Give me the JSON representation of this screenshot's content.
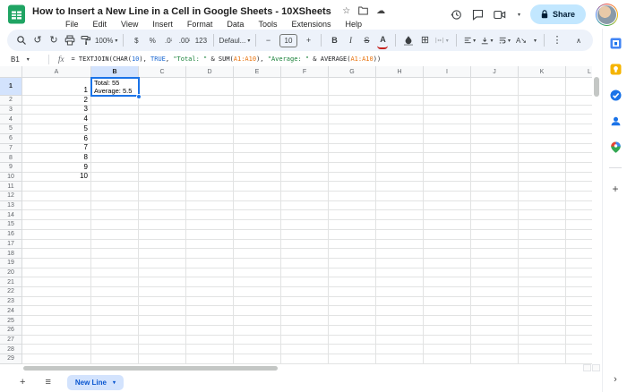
{
  "titlebar": {
    "title": "How to Insert a New Line in a Cell in Google Sheets - 10XSheets",
    "menu_items": [
      "File",
      "Edit",
      "View",
      "Insert",
      "Format",
      "Data",
      "Tools",
      "Extensions",
      "Help"
    ],
    "share_label": "Share"
  },
  "icons": {
    "star": "☆",
    "cloud": "☁",
    "undo": "↺",
    "redo": "↻",
    "borders": "⊞",
    "caret": "▾",
    "menu": "≡",
    "plus": "+",
    "chevron_right": "›",
    "rotate_hint": "A↘"
  },
  "toolbar": {
    "zoom_value": "100%",
    "font_name": "Defaul...",
    "font_size": "10",
    "labels": {
      "currency": "$",
      "percent": "%",
      "decrease_decimal": ".0",
      "increase_decimal": ".00",
      "number_format": "123",
      "decrease_font": "−",
      "increase_font": "+",
      "bold": "B",
      "italic": "I",
      "strikethrough": "S",
      "text_color": "A",
      "more": "⋮",
      "collapse": "∧"
    }
  },
  "formula_bar": {
    "cell_reference": "B1",
    "fx_label": "fx",
    "segments": [
      {
        "text": "= TEXTJOIN(CHAR(",
        "color": "#202124"
      },
      {
        "text": "10",
        "color": "#1967d2"
      },
      {
        "text": "), ",
        "color": "#202124"
      },
      {
        "text": "TRUE",
        "color": "#1967d2"
      },
      {
        "text": ", ",
        "color": "#202124"
      },
      {
        "text": "\"Total: \"",
        "color": "#188038"
      },
      {
        "text": " & SUM(",
        "color": "#202124"
      },
      {
        "text": "A1:A10",
        "color": "#e8710a"
      },
      {
        "text": "), ",
        "color": "#202124"
      },
      {
        "text": "\"Average: \"",
        "color": "#188038"
      },
      {
        "text": " & AVERAGE(",
        "color": "#202124"
      },
      {
        "text": "A1:A10",
        "color": "#e8710a"
      },
      {
        "text": "))",
        "color": "#202124"
      }
    ]
  },
  "grid": {
    "columns": [
      "A",
      "B",
      "C",
      "D",
      "E",
      "F",
      "G",
      "H",
      "I",
      "J",
      "K",
      "L"
    ],
    "visible_rows": 29,
    "selected_cell": "B1",
    "selected_column": "B",
    "selected_row": 1,
    "column_a_values": [
      "1",
      "2",
      "3",
      "4",
      "5",
      "6",
      "7",
      "8",
      "9",
      "10"
    ],
    "b1_lines": [
      "Total: 55",
      "Average: 5.5"
    ]
  },
  "tabbar": {
    "sheet_name": "New Line"
  },
  "side_panel": {
    "icons": [
      "calendar-icon",
      "keep-icon",
      "tasks-icon",
      "contacts-icon",
      "maps-icon",
      "add-addon-icon",
      "collapse-panel-icon"
    ]
  },
  "colors": {
    "selection_blue": "#1a73e8",
    "selected_header_bg": "#d3e3fd",
    "toolbar_bg": "#edf2fa",
    "share_bg": "#c2e7ff",
    "active_tab_bg": "#d3e3fd",
    "active_tab_text": "#0b57d0",
    "formula_string": "#188038",
    "formula_number": "#1967d2",
    "formula_range": "#e8710a"
  }
}
